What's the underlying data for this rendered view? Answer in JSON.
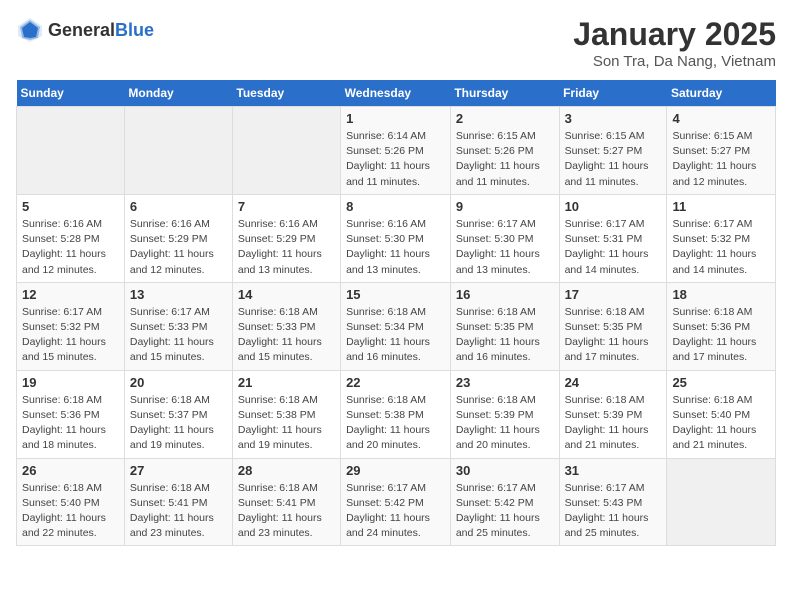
{
  "header": {
    "logo_general": "General",
    "logo_blue": "Blue",
    "title": "January 2025",
    "subtitle": "Son Tra, Da Nang, Vietnam"
  },
  "days_of_week": [
    "Sunday",
    "Monday",
    "Tuesday",
    "Wednesday",
    "Thursday",
    "Friday",
    "Saturday"
  ],
  "weeks": [
    [
      {
        "day": "",
        "info": ""
      },
      {
        "day": "",
        "info": ""
      },
      {
        "day": "",
        "info": ""
      },
      {
        "day": "1",
        "info": "Sunrise: 6:14 AM\nSunset: 5:26 PM\nDaylight: 11 hours\nand 11 minutes."
      },
      {
        "day": "2",
        "info": "Sunrise: 6:15 AM\nSunset: 5:26 PM\nDaylight: 11 hours\nand 11 minutes."
      },
      {
        "day": "3",
        "info": "Sunrise: 6:15 AM\nSunset: 5:27 PM\nDaylight: 11 hours\nand 11 minutes."
      },
      {
        "day": "4",
        "info": "Sunrise: 6:15 AM\nSunset: 5:27 PM\nDaylight: 11 hours\nand 12 minutes."
      }
    ],
    [
      {
        "day": "5",
        "info": "Sunrise: 6:16 AM\nSunset: 5:28 PM\nDaylight: 11 hours\nand 12 minutes."
      },
      {
        "day": "6",
        "info": "Sunrise: 6:16 AM\nSunset: 5:29 PM\nDaylight: 11 hours\nand 12 minutes."
      },
      {
        "day": "7",
        "info": "Sunrise: 6:16 AM\nSunset: 5:29 PM\nDaylight: 11 hours\nand 13 minutes."
      },
      {
        "day": "8",
        "info": "Sunrise: 6:16 AM\nSunset: 5:30 PM\nDaylight: 11 hours\nand 13 minutes."
      },
      {
        "day": "9",
        "info": "Sunrise: 6:17 AM\nSunset: 5:30 PM\nDaylight: 11 hours\nand 13 minutes."
      },
      {
        "day": "10",
        "info": "Sunrise: 6:17 AM\nSunset: 5:31 PM\nDaylight: 11 hours\nand 14 minutes."
      },
      {
        "day": "11",
        "info": "Sunrise: 6:17 AM\nSunset: 5:32 PM\nDaylight: 11 hours\nand 14 minutes."
      }
    ],
    [
      {
        "day": "12",
        "info": "Sunrise: 6:17 AM\nSunset: 5:32 PM\nDaylight: 11 hours\nand 15 minutes."
      },
      {
        "day": "13",
        "info": "Sunrise: 6:17 AM\nSunset: 5:33 PM\nDaylight: 11 hours\nand 15 minutes."
      },
      {
        "day": "14",
        "info": "Sunrise: 6:18 AM\nSunset: 5:33 PM\nDaylight: 11 hours\nand 15 minutes."
      },
      {
        "day": "15",
        "info": "Sunrise: 6:18 AM\nSunset: 5:34 PM\nDaylight: 11 hours\nand 16 minutes."
      },
      {
        "day": "16",
        "info": "Sunrise: 6:18 AM\nSunset: 5:35 PM\nDaylight: 11 hours\nand 16 minutes."
      },
      {
        "day": "17",
        "info": "Sunrise: 6:18 AM\nSunset: 5:35 PM\nDaylight: 11 hours\nand 17 minutes."
      },
      {
        "day": "18",
        "info": "Sunrise: 6:18 AM\nSunset: 5:36 PM\nDaylight: 11 hours\nand 17 minutes."
      }
    ],
    [
      {
        "day": "19",
        "info": "Sunrise: 6:18 AM\nSunset: 5:36 PM\nDaylight: 11 hours\nand 18 minutes."
      },
      {
        "day": "20",
        "info": "Sunrise: 6:18 AM\nSunset: 5:37 PM\nDaylight: 11 hours\nand 19 minutes."
      },
      {
        "day": "21",
        "info": "Sunrise: 6:18 AM\nSunset: 5:38 PM\nDaylight: 11 hours\nand 19 minutes."
      },
      {
        "day": "22",
        "info": "Sunrise: 6:18 AM\nSunset: 5:38 PM\nDaylight: 11 hours\nand 20 minutes."
      },
      {
        "day": "23",
        "info": "Sunrise: 6:18 AM\nSunset: 5:39 PM\nDaylight: 11 hours\nand 20 minutes."
      },
      {
        "day": "24",
        "info": "Sunrise: 6:18 AM\nSunset: 5:39 PM\nDaylight: 11 hours\nand 21 minutes."
      },
      {
        "day": "25",
        "info": "Sunrise: 6:18 AM\nSunset: 5:40 PM\nDaylight: 11 hours\nand 21 minutes."
      }
    ],
    [
      {
        "day": "26",
        "info": "Sunrise: 6:18 AM\nSunset: 5:40 PM\nDaylight: 11 hours\nand 22 minutes."
      },
      {
        "day": "27",
        "info": "Sunrise: 6:18 AM\nSunset: 5:41 PM\nDaylight: 11 hours\nand 23 minutes."
      },
      {
        "day": "28",
        "info": "Sunrise: 6:18 AM\nSunset: 5:41 PM\nDaylight: 11 hours\nand 23 minutes."
      },
      {
        "day": "29",
        "info": "Sunrise: 6:17 AM\nSunset: 5:42 PM\nDaylight: 11 hours\nand 24 minutes."
      },
      {
        "day": "30",
        "info": "Sunrise: 6:17 AM\nSunset: 5:42 PM\nDaylight: 11 hours\nand 25 minutes."
      },
      {
        "day": "31",
        "info": "Sunrise: 6:17 AM\nSunset: 5:43 PM\nDaylight: 11 hours\nand 25 minutes."
      },
      {
        "day": "",
        "info": ""
      }
    ]
  ]
}
